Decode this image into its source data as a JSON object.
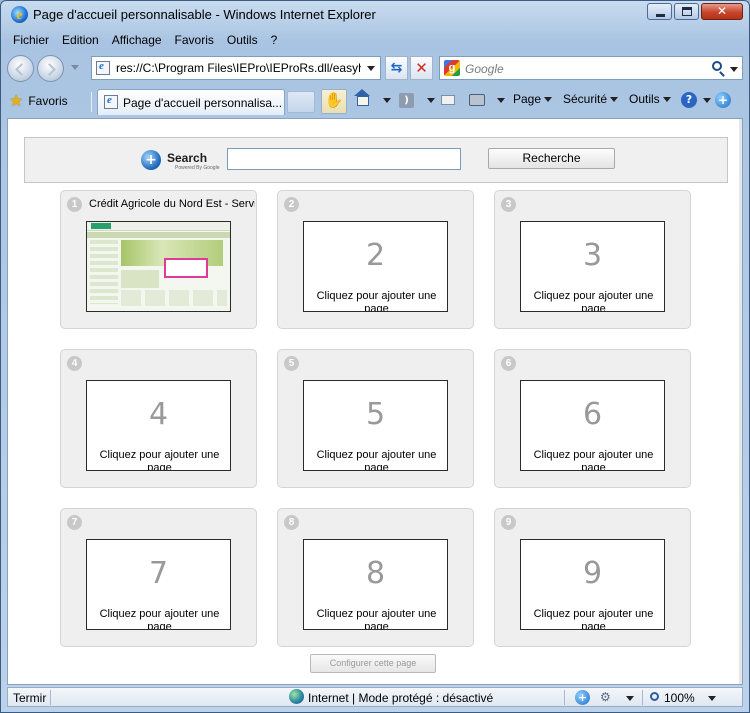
{
  "window": {
    "title": "Page d'accueil personnalisable - Windows Internet Explorer",
    "close_glyph": "✕"
  },
  "menu": {
    "items": [
      "Fichier",
      "Edition",
      "Affichage",
      "Favoris",
      "Outils",
      "?"
    ]
  },
  "address_bar": {
    "url": "res://C:\\Program Files\\IEPro\\IEProRs.dll/easyh"
  },
  "search_provider": {
    "placeholder": "Google"
  },
  "toolbar": {
    "favorites_label": "Favoris",
    "tab_label": "Page d'accueil personnalisa...",
    "page_label": "Page",
    "security_label": "Sécurité",
    "tools_label": "Outils"
  },
  "page": {
    "search_title": "Search",
    "search_subtitle": "Powered By Google",
    "search_button": "Recherche",
    "configure_button": "Configurer cette page",
    "tiles": [
      {
        "number": "1",
        "title": "Crédit Agricole du Nord Est - Servic",
        "big": "",
        "cta": ""
      },
      {
        "number": "2",
        "title": "",
        "big": "2",
        "cta": "Cliquez pour ajouter une page"
      },
      {
        "number": "3",
        "title": "",
        "big": "3",
        "cta": "Cliquez pour ajouter une page"
      },
      {
        "number": "4",
        "title": "",
        "big": "4",
        "cta": "Cliquez pour ajouter une page"
      },
      {
        "number": "5",
        "title": "",
        "big": "5",
        "cta": "Cliquez pour ajouter une page"
      },
      {
        "number": "6",
        "title": "",
        "big": "6",
        "cta": "Cliquez pour ajouter une page"
      },
      {
        "number": "7",
        "title": "",
        "big": "7",
        "cta": "Cliquez pour ajouter une page"
      },
      {
        "number": "8",
        "title": "",
        "big": "8",
        "cta": "Cliquez pour ajouter une page"
      },
      {
        "number": "9",
        "title": "",
        "big": "9",
        "cta": "Cliquez pour ajouter une page"
      }
    ]
  },
  "status_bar": {
    "text": "Termir",
    "zone": "Internet | Mode protégé : désactivé",
    "zoom": "100%"
  }
}
